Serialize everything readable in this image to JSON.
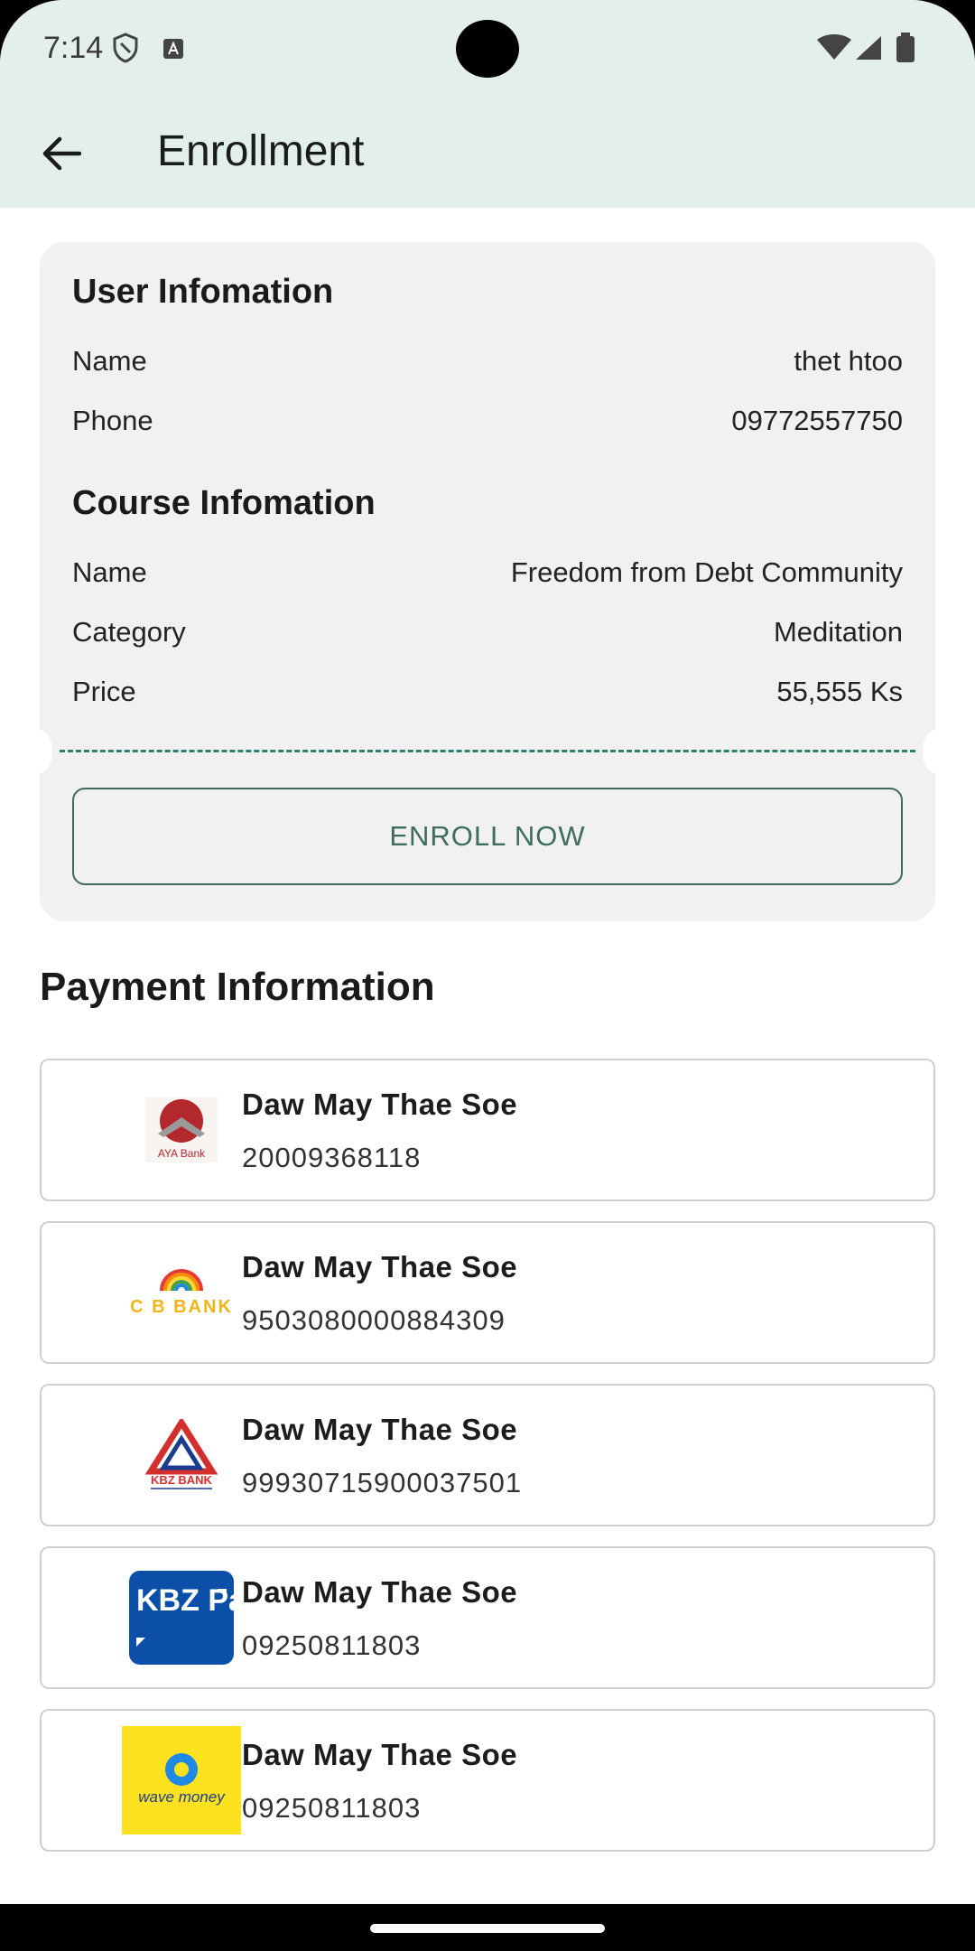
{
  "status_bar": {
    "time": "7:14"
  },
  "app_bar": {
    "title": "Enrollment"
  },
  "user_info": {
    "title": "User Infomation",
    "rows": [
      {
        "label": "Name",
        "value": "thet htoo"
      },
      {
        "label": "Phone",
        "value": "09772557750"
      }
    ]
  },
  "course_info": {
    "title": "Course Infomation",
    "rows": [
      {
        "label": "Name",
        "value": "Freedom from Debt Community"
      },
      {
        "label": "Category",
        "value": "Meditation"
      },
      {
        "label": "Price",
        "value": "55,555 Ks"
      }
    ]
  },
  "enroll_button": {
    "label": "ENROLL NOW"
  },
  "payment": {
    "title": "Payment Information",
    "methods": [
      {
        "logo": "aya-bank-logo",
        "logo_text": "AYA Bank",
        "name": "Daw May Thae Soe",
        "number": "20009368118"
      },
      {
        "logo": "cb-bank-logo",
        "logo_text": "C B BANK",
        "name": "Daw May Thae Soe",
        "number": "9503080000884309"
      },
      {
        "logo": "kbz-bank-logo",
        "logo_text": "KBZ BANK",
        "name": "Daw May Thae Soe",
        "number": "99930715900037501"
      },
      {
        "logo": "kbz-pay-logo",
        "logo_text": "KBZ Pay",
        "name": "Daw May Thae Soe",
        "number": "09250811803"
      },
      {
        "logo": "wave-money-logo",
        "logo_text": "wave money",
        "name": "Daw May Thae Soe",
        "number": "09250811803"
      }
    ]
  },
  "colors": {
    "app_bar_bg": "#e3efea",
    "card_bg": "#f1f1f1",
    "accent": "#2e7f6d",
    "button_border": "#3d6b5b"
  }
}
